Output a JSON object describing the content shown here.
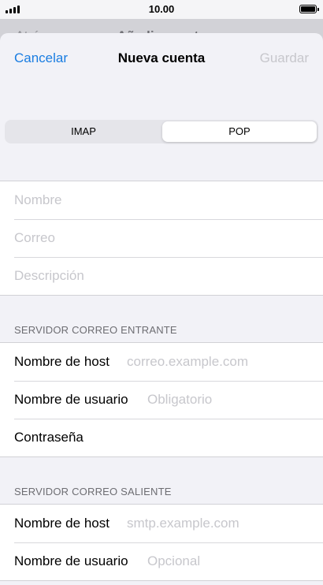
{
  "status_bar": {
    "time": "10.00"
  },
  "background_nav": {
    "back_label": "Atrás",
    "title": "Añadir cuenta"
  },
  "nav": {
    "cancel_label": "Cancelar",
    "title": "Nueva cuenta",
    "save_label": "Guardar"
  },
  "segmented": {
    "options": [
      "IMAP",
      "POP"
    ],
    "selected": "POP"
  },
  "account_info": {
    "name_placeholder": "Nombre",
    "email_placeholder": "Correo",
    "description_placeholder": "Descripción"
  },
  "incoming": {
    "header": "SERVIDOR CORREO ENTRANTE",
    "host_label": "Nombre de host",
    "host_placeholder": "correo.example.com",
    "username_label": "Nombre de usuario",
    "username_placeholder": "Obligatorio",
    "password_label": "Contraseña"
  },
  "outgoing": {
    "header": "SERVIDOR CORREO SALIENTE",
    "host_label": "Nombre de host",
    "host_placeholder": "smtp.example.com",
    "username_label": "Nombre de usuario",
    "username_placeholder": "Opcional"
  },
  "colors": {
    "accent": "#1a7de1",
    "disabled": "#c7c7cc",
    "background": "#f2f2f7"
  },
  "icons": {
    "signal": "cellular-signal-icon",
    "battery": "battery-icon",
    "back": "chevron-left-icon"
  }
}
